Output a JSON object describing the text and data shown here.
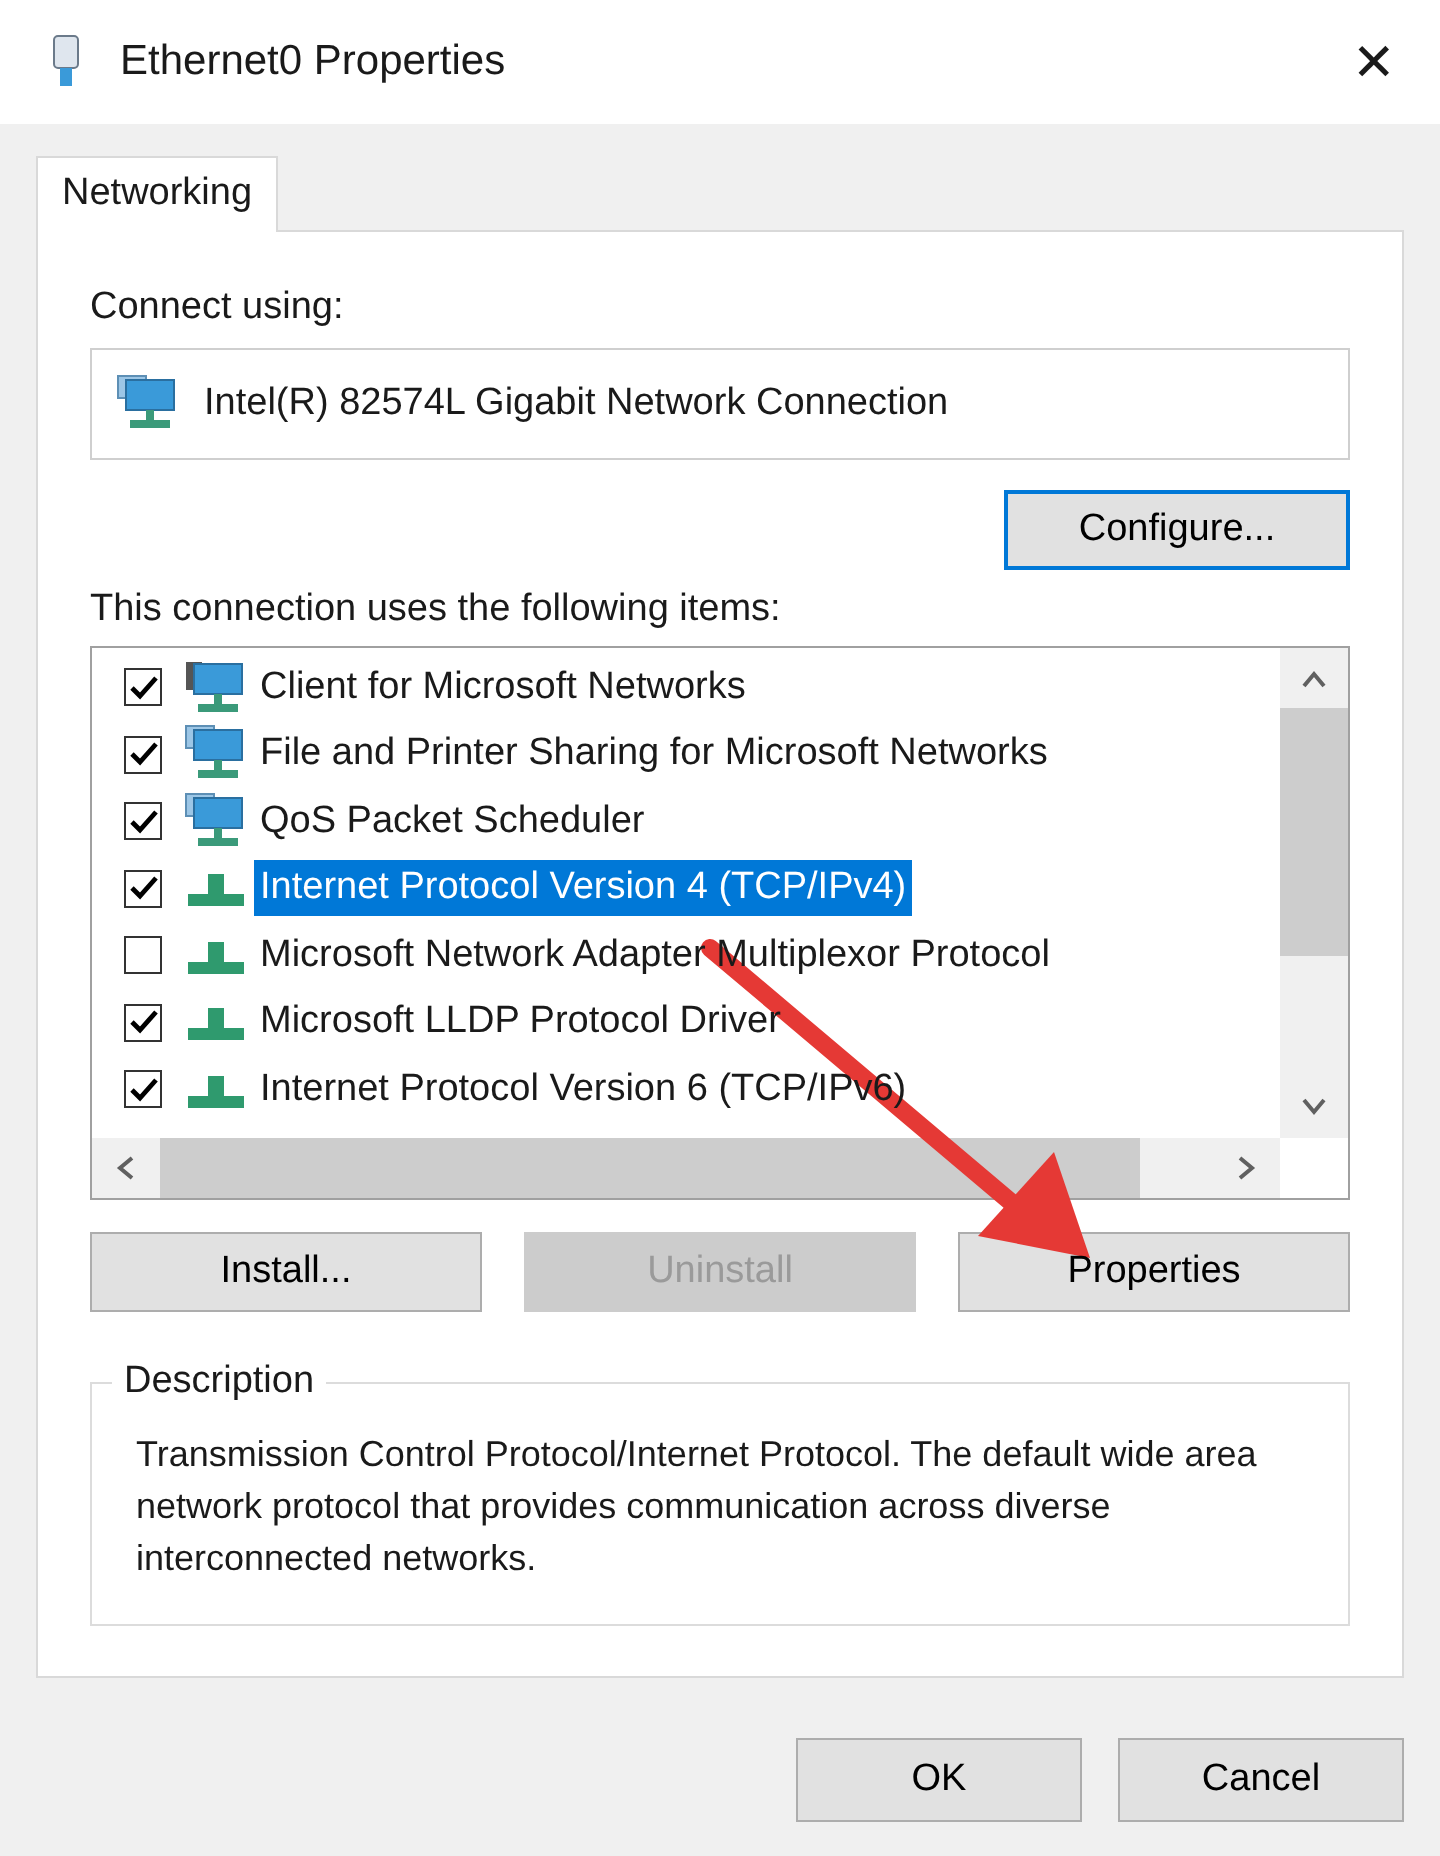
{
  "window": {
    "title": "Ethernet0 Properties",
    "close": "✕"
  },
  "tabs": [
    {
      "label": "Networking",
      "selected": true
    }
  ],
  "connect_using": {
    "label": "Connect using:",
    "adapter": "Intel(R) 82574L Gigabit Network Connection",
    "configure_button": "Configure..."
  },
  "items_label": "This connection uses the following items:",
  "items": [
    {
      "kind": "client",
      "label": "Client for Microsoft Networks",
      "checked": true,
      "selected": false
    },
    {
      "kind": "service",
      "label": "File and Printer Sharing for Microsoft Networks",
      "checked": true,
      "selected": false
    },
    {
      "kind": "service",
      "label": "QoS Packet Scheduler",
      "checked": true,
      "selected": false
    },
    {
      "kind": "protocol",
      "label": "Internet Protocol Version 4 (TCP/IPv4)",
      "checked": true,
      "selected": true
    },
    {
      "kind": "protocol",
      "label": "Microsoft Network Adapter Multiplexor Protocol",
      "checked": false,
      "selected": false
    },
    {
      "kind": "protocol",
      "label": "Microsoft LLDP Protocol Driver",
      "checked": true,
      "selected": false
    },
    {
      "kind": "protocol",
      "label": "Internet Protocol Version 6 (TCP/IPv6)",
      "checked": true,
      "selected": false
    }
  ],
  "item_buttons": [
    {
      "label": "Install...",
      "disabled": false
    },
    {
      "label": "Uninstall",
      "disabled": true
    },
    {
      "label": "Properties",
      "disabled": false
    }
  ],
  "description": {
    "title": "Description",
    "text": "Transmission Control Protocol/Internet Protocol. The default wide area network protocol that provides communication across diverse interconnected networks."
  },
  "buttons": [
    "OK",
    "Cancel"
  ]
}
